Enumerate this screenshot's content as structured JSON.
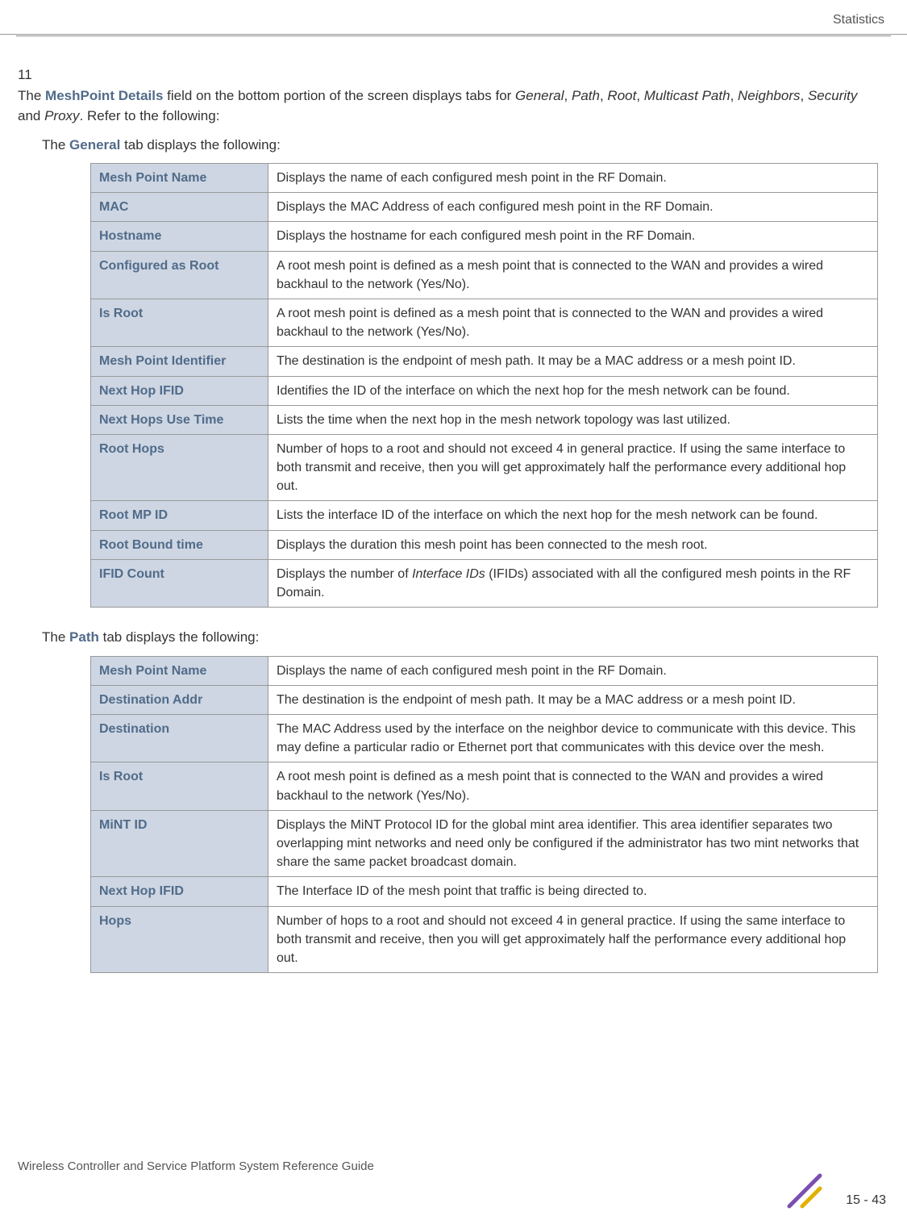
{
  "header": {
    "section": "Statistics"
  },
  "intro": {
    "list_number": "11",
    "text_1a": "The ",
    "bold_1": "MeshPoint Details",
    "text_1b": " field on the bottom portion of the screen displays tabs for ",
    "italic_general": "General",
    "sep1": ", ",
    "italic_path": "Path",
    "sep2": ", ",
    "italic_root": "Root",
    "sep3": ", ",
    "italic_multicast": "Multicast Path",
    "sep4": ", ",
    "italic_neighbors": "Neighbors",
    "sep5": ", ",
    "italic_security": "Security",
    "sep6": " and ",
    "italic_proxy": "Proxy",
    "text_1c": ". Refer to the following:",
    "text_2a": "The ",
    "bold_2": "General",
    "text_2b": " tab displays the following:",
    "text_3a": "The ",
    "bold_3": "Path",
    "text_3b": " tab displays the following:"
  },
  "general_table": {
    "rows": [
      {
        "label": "Mesh Point Name",
        "desc": "Displays the name of each configured mesh point in the RF Domain."
      },
      {
        "label": "MAC",
        "desc": "Displays the MAC Address of each configured mesh point in the RF Domain."
      },
      {
        "label": "Hostname",
        "desc": "Displays the hostname for each configured mesh point in the RF Domain."
      },
      {
        "label": "Configured as Root",
        "desc": "A root mesh point is defined as a mesh point that is connected to the WAN and provides a wired backhaul to the network (Yes/No)."
      },
      {
        "label": "Is Root",
        "desc": "A root mesh point is defined as a mesh point that is connected to the WAN and provides a wired backhaul to the network (Yes/No)."
      },
      {
        "label": "Mesh Point Identifier",
        "desc": "The destination is the endpoint of mesh path. It may be a MAC address or a mesh point ID."
      },
      {
        "label": "Next Hop IFID",
        "desc": "Identifies the ID of the interface on which the next hop for the mesh network can be found."
      },
      {
        "label": "Next Hops Use Time",
        "desc": "Lists the time when the next hop in the mesh network topology was last utilized."
      },
      {
        "label": "Root Hops",
        "desc": "Number of hops to a root and should not exceed 4 in general practice. If using the same interface to both transmit and receive, then you will get approximately half the performance every additional hop out."
      },
      {
        "label": "Root MP ID",
        "desc": "Lists the interface ID of the interface on which the next hop for the mesh network can be found."
      },
      {
        "label": "Root Bound time",
        "desc": "Displays the duration this mesh point has been connected to the mesh root."
      },
      {
        "label": "IFID Count",
        "desc_a": "Displays the number of ",
        "desc_italic": "Interface IDs",
        "desc_b": " (IFIDs) associated with all the configured mesh points in the RF Domain."
      }
    ]
  },
  "path_table": {
    "rows": [
      {
        "label": "Mesh Point Name",
        "desc": "Displays the name of each configured mesh point in the RF Domain."
      },
      {
        "label": "Destination Addr",
        "desc": "The destination is the endpoint of mesh path. It may be a MAC address or a mesh point ID."
      },
      {
        "label": "Destination",
        "desc": "The MAC Address used by the interface on the neighbor device to communicate with this device. This may define a particular radio or Ethernet port that communicates with this device over the mesh."
      },
      {
        "label": "Is Root",
        "desc": "A root mesh point is defined as a mesh point that is connected to the WAN and provides a wired backhaul to the network (Yes/No)."
      },
      {
        "label": "MiNT ID",
        "desc": "Displays the MiNT Protocol ID for the global mint area identifier. This area identifier separates two overlapping mint networks and need only be configured if the administrator has two mint networks that share the same packet broadcast domain."
      },
      {
        "label": "Next Hop IFID",
        "desc": "The Interface ID of the mesh point that traffic is being directed to."
      },
      {
        "label": "Hops",
        "desc": "Number of hops to a root and should not exceed 4 in general practice. If using the same interface to both transmit and receive, then you will get approximately half the performance every additional hop out."
      }
    ]
  },
  "footer": {
    "text": "Wireless Controller and Service Platform System Reference Guide",
    "page": "15 - 43"
  }
}
